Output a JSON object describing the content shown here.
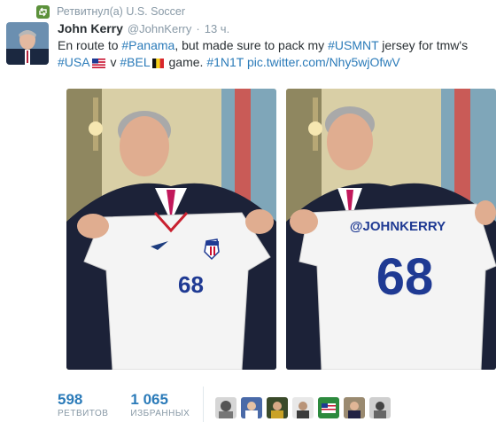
{
  "retweet": {
    "text": "Ретвитнул(а) U.S. Soccer",
    "icon": "retweet-icon"
  },
  "tweet": {
    "fullname": "John Kerry",
    "username": "@JohnKerry",
    "separator": "·",
    "timestamp": "13 ч.",
    "text_parts": {
      "p1": "En route to ",
      "h_panama": "#Panama",
      "p2": ", but made sure to pack my ",
      "h_usmnt": "#USMNT",
      "p3": " jersey for tmw's",
      "h_usa": "#USA",
      "p4": " v ",
      "h_bel": "#BEL",
      "p5": " game. ",
      "h_1n1t": "#1N1T",
      "p6": " ",
      "link": "pic.twitter.com/Nhy5wjOfwV"
    }
  },
  "photos": [
    {
      "jersey_number": "68",
      "caption_on_jersey": ""
    },
    {
      "jersey_number": "68",
      "caption_on_jersey": "@JOHNKERRY"
    }
  ],
  "stats": {
    "retweets": {
      "value": "598",
      "label": "РЕТВИТОВ"
    },
    "favorites": {
      "value": "1 065",
      "label": "ИЗБРАННЫХ"
    }
  },
  "colors": {
    "link": "#2b7bb9",
    "muted": "#8899a6",
    "retweet_green": "#5c913b"
  }
}
